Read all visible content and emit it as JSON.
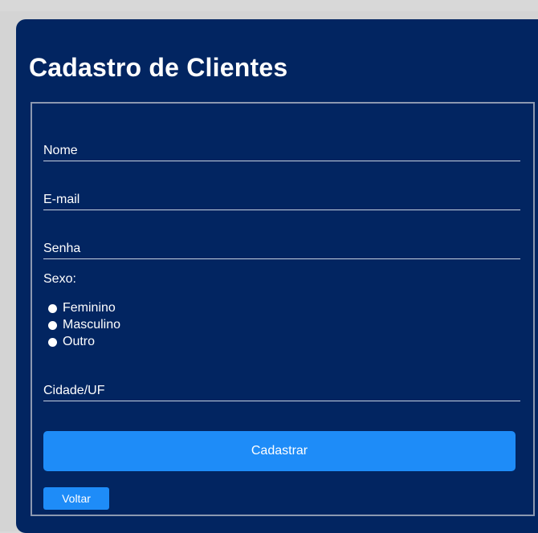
{
  "form": {
    "title": "Cadastro de Clientes",
    "fields": {
      "nome_placeholder": "Nome",
      "email_placeholder": "E-mail",
      "senha_placeholder": "Senha",
      "cidade_placeholder": "Cidade/UF"
    },
    "sexo": {
      "label": "Sexo:",
      "options": [
        "Feminino",
        "Masculino",
        "Outro"
      ]
    },
    "submit_label": "Cadastrar",
    "back_label": "Voltar"
  },
  "colors": {
    "card_background": "#022561",
    "button": "#1e8cf8",
    "text": "#ffffff",
    "border": "#8c98b0"
  }
}
